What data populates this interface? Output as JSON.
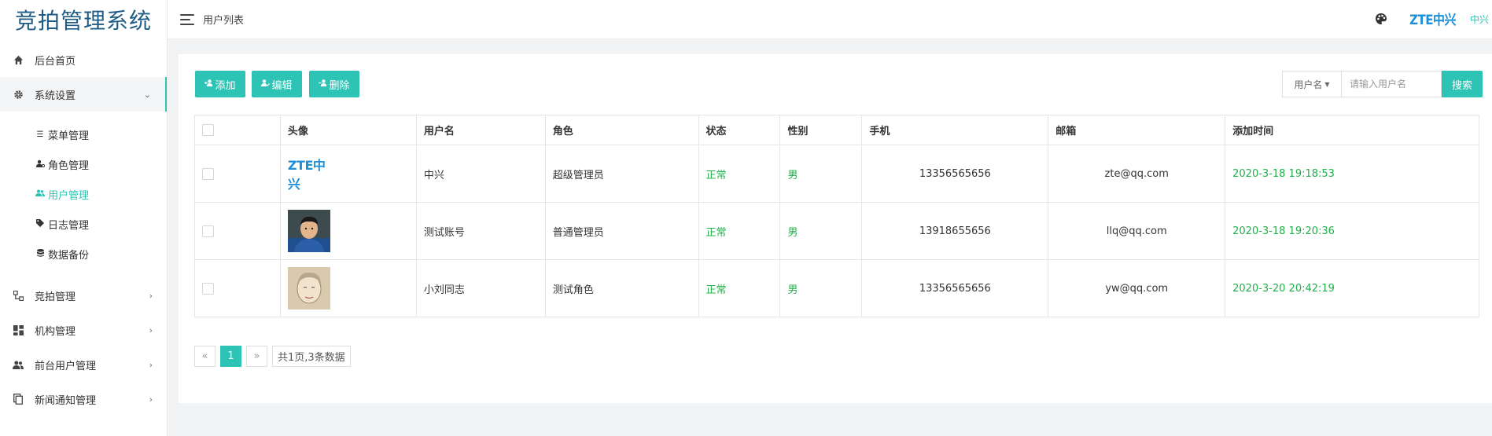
{
  "app": {
    "title": "竞拍管理系统"
  },
  "header": {
    "breadcrumb": "用户列表",
    "logo_text": "ZTE中兴",
    "user_name": "中兴"
  },
  "sidebar": {
    "home": "后台首页",
    "system": {
      "label": "系统设置",
      "items": [
        {
          "label": "菜单管理",
          "icon": "list-icon"
        },
        {
          "label": "角色管理",
          "icon": "user-gear-icon"
        },
        {
          "label": "用户管理",
          "icon": "users-icon"
        },
        {
          "label": "日志管理",
          "icon": "tag-icon"
        },
        {
          "label": "数据备份",
          "icon": "database-icon"
        }
      ]
    },
    "groups": [
      {
        "label": "竞拍管理",
        "icon": "sitemap-icon"
      },
      {
        "label": "机构管理",
        "icon": "dashboard-icon"
      },
      {
        "label": "前台用户管理",
        "icon": "users-icon"
      },
      {
        "label": "新闻通知管理",
        "icon": "copy-icon"
      }
    ]
  },
  "toolbar": {
    "add": "添加",
    "edit": "编辑",
    "delete": "删除",
    "search_field": "用户名",
    "search_placeholder": "请输入用户名",
    "search_button": "搜索"
  },
  "table": {
    "headers": [
      "头像",
      "用户名",
      "角色",
      "状态",
      "性别",
      "手机",
      "邮箱",
      "添加时间"
    ],
    "rows": [
      {
        "avatar_text": "ZTE中兴",
        "username": "中兴",
        "role": "超级管理员",
        "status": "正常",
        "gender": "男",
        "phone": "13356565656",
        "email": "zte@qq.com",
        "added": "2020-3-18 19:18:53"
      },
      {
        "username": "测试账号",
        "role": "普通管理员",
        "status": "正常",
        "gender": "男",
        "phone": "13918655656",
        "email": "llq@qq.com",
        "added": "2020-3-18 19:20:36"
      },
      {
        "username": "小刘同志",
        "role": "测试角色",
        "status": "正常",
        "gender": "男",
        "phone": "13356565656",
        "email": "yw@qq.com",
        "added": "2020-3-20 20:42:19"
      }
    ]
  },
  "pagination": {
    "prev": "«",
    "current": "1",
    "next": "»",
    "summary": "共1页,3条数据"
  },
  "colors": {
    "accent": "#2dc3b5",
    "status_green": "#20b04a",
    "brand_blue": "#1e5c86"
  }
}
